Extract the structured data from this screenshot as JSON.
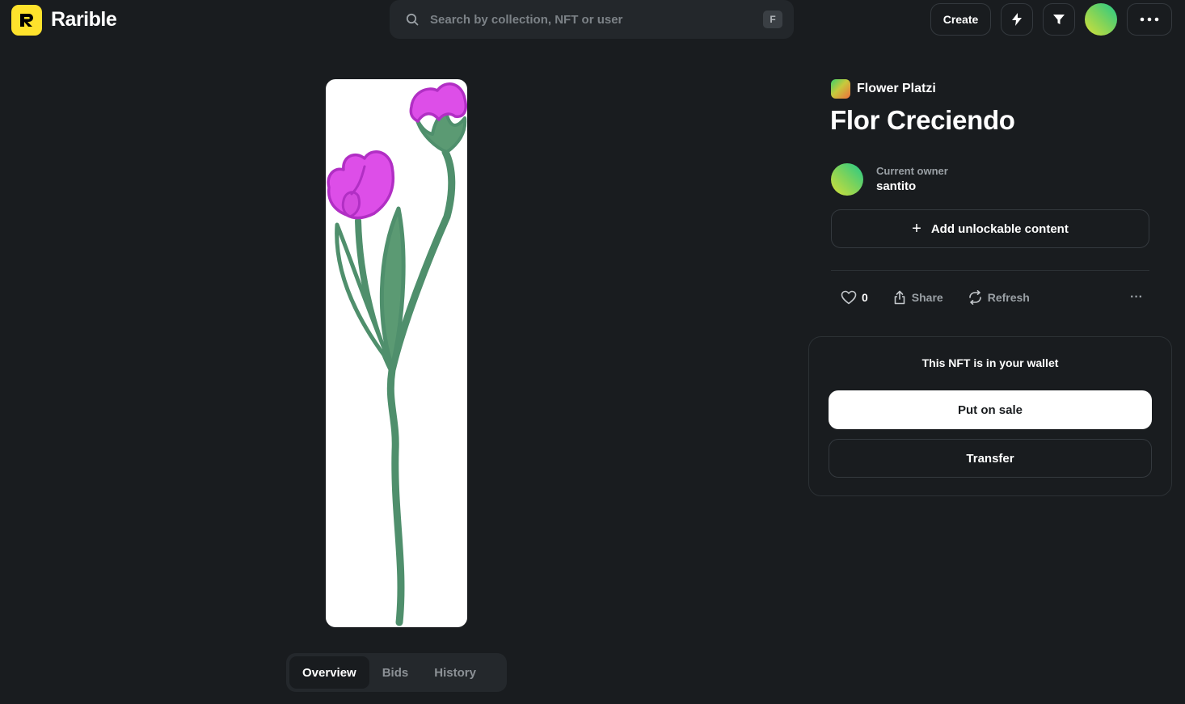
{
  "header": {
    "logo_text": "Rarible",
    "logo_mark": "R",
    "search": {
      "placeholder": "Search by collection, NFT or user",
      "shortcut": "F"
    },
    "create_label": "Create",
    "icons": [
      "bolt-icon",
      "filter-icon",
      "more-horizontal-icon"
    ]
  },
  "artwork": {
    "background": "#ffffff",
    "petal_color": "#dd4ee8",
    "stem_color": "#4f8f6c"
  },
  "tabs": [
    {
      "label": "Overview",
      "active": true
    },
    {
      "label": "Bids",
      "active": false
    },
    {
      "label": "History",
      "active": false
    }
  ],
  "nft": {
    "collection": "Flower Platzi",
    "title": "Flor Creciendo",
    "owner_label": "Current owner",
    "owner_name": "santito",
    "unlockable_label": "Add unlockable content",
    "likes": "0",
    "share_label": "Share",
    "refresh_label": "Refresh",
    "more_label": "···"
  },
  "wallet": {
    "message": "This NFT is in your wallet",
    "put_on_sale_label": "Put on sale",
    "transfer_label": "Transfer"
  },
  "colors": {
    "background": "#191c1f",
    "brand_yellow": "#fee22c",
    "border": "#34393e"
  }
}
